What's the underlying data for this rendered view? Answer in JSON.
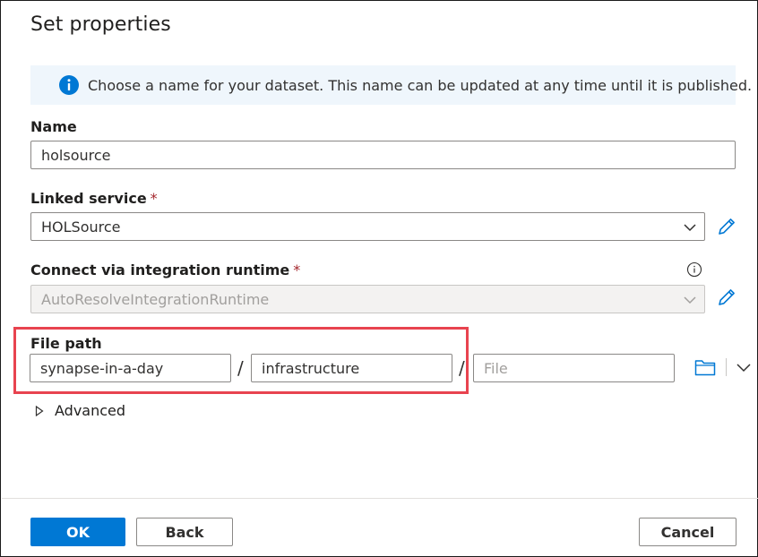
{
  "dialog": {
    "title": "Set properties",
    "info_message": "Choose a name for your dataset. This name can be updated at any time until it is published."
  },
  "name": {
    "label": "Name",
    "value": "holsource"
  },
  "linked_service": {
    "label": "Linked service",
    "required_mark": "*",
    "value": "HOLSource"
  },
  "integration_runtime": {
    "label": "Connect via integration runtime",
    "required_mark": "*",
    "value": "AutoResolveIntegrationRuntime"
  },
  "file_path": {
    "label": "File path",
    "container": "synapse-in-a-day",
    "separator": "/",
    "directory": "infrastructure",
    "file_placeholder": "File",
    "highlight_color": "#e8434f"
  },
  "advanced": {
    "label": "Advanced"
  },
  "footer": {
    "ok_label": "OK",
    "back_label": "Back",
    "cancel_label": "Cancel"
  },
  "colors": {
    "accent": "#0078d4",
    "info_bg": "#eff6fc",
    "required": "#a4262c"
  }
}
